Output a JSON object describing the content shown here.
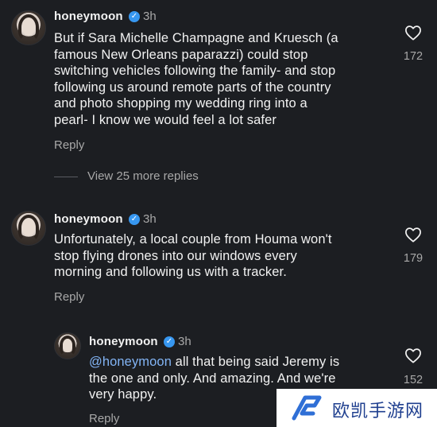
{
  "comments": [
    {
      "username": "honeymoon",
      "time": "3h",
      "text": "But if Sara Michelle Champagne and Kruesch (a\nfamous New Orleans paparazzi) could stop\nswitching vehicles following the family- and  stop\nfollowing us around remote parts of the country\nand photo shopping my wedding ring into a\npearl- I know we would feel a lot safer",
      "reply_label": "Reply",
      "likes": "172",
      "view_more": "View 25 more replies"
    },
    {
      "username": "honeymoon",
      "time": "3h",
      "text": "Unfortunately, a local couple from Houma won't\nstop flying drones into our windows every\nmorning and following us with a tracker.",
      "reply_label": "Reply",
      "likes": "179"
    },
    {
      "username": "honeymoon",
      "time": "3h",
      "mention": "@honeymoon",
      "text": " all that being said Jeremy is\nthe one and only. And amazing. And we're\nvery happy.",
      "reply_label": "Reply",
      "likes": "152"
    }
  ],
  "watermark": {
    "text": "欧凯手游网"
  },
  "icons": {
    "verified": "verified-badge-icon",
    "like": "heart-icon"
  },
  "colors": {
    "background": "#1c1e22",
    "verified": "#3797f0",
    "mention": "#82b4f5"
  }
}
